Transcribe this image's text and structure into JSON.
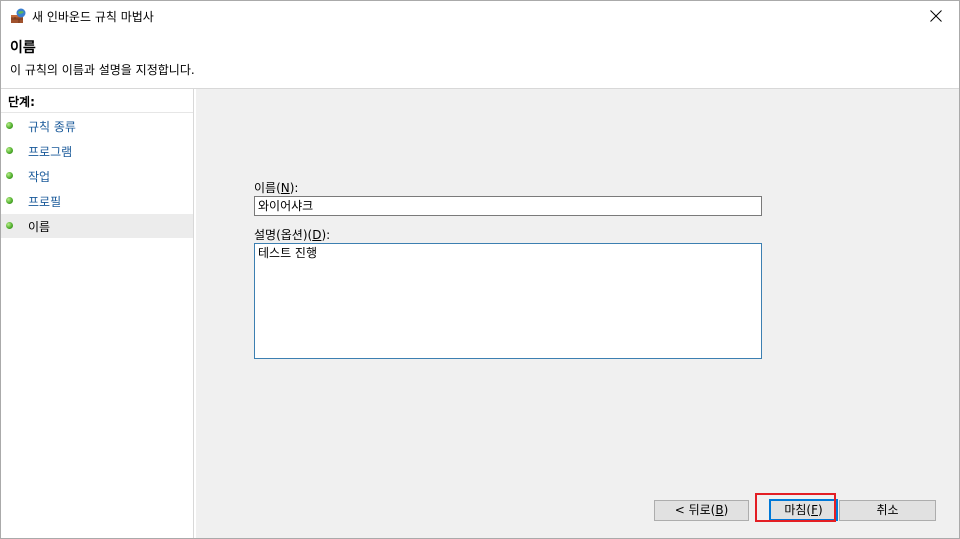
{
  "window": {
    "title": "새 인바운드 규칙 마법사"
  },
  "header": {
    "title": "이름",
    "subtitle": "이 규칙의 이름과 설명을 지정합니다."
  },
  "sidebar": {
    "heading": "단계:",
    "steps": [
      {
        "label": "규칙 종류",
        "current": false
      },
      {
        "label": "프로그램",
        "current": false
      },
      {
        "label": "작업",
        "current": false
      },
      {
        "label": "프로필",
        "current": false
      },
      {
        "label": "이름",
        "current": true
      }
    ]
  },
  "form": {
    "name_label_prefix": "이름(",
    "name_label_accel": "N",
    "name_label_suffix": "):",
    "name_value": "와이어샤크",
    "desc_label_prefix": "설명(옵션)(",
    "desc_label_accel": "D",
    "desc_label_suffix": "):",
    "desc_value": "테스트 진행"
  },
  "buttons": {
    "back_prefix": "< 뒤로(",
    "back_accel": "B",
    "back_suffix": ")",
    "finish_prefix": "마침(",
    "finish_accel": "F",
    "finish_suffix": ")",
    "cancel": "취소"
  },
  "colors": {
    "step_link": "#1a5a9a",
    "content_bg": "#f0f0f0",
    "focus_blue": "#0078d7",
    "highlight_red": "#e31e24"
  }
}
